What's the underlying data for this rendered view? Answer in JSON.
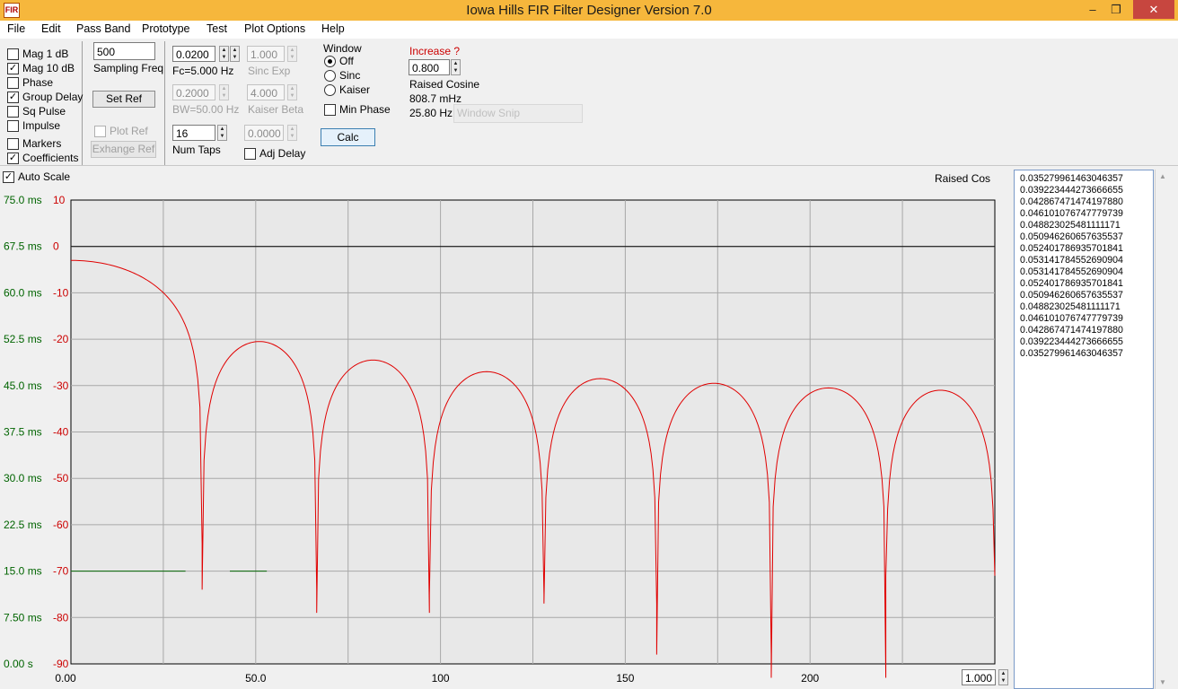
{
  "window": {
    "title": "Iowa Hills FIR Filter Designer  Version 7.0",
    "icon_label": "FIR",
    "minimize": "–",
    "maximize": "❐",
    "close": "✕"
  },
  "menu": [
    "File",
    "Edit",
    "Pass Band",
    "Prototype",
    "Test",
    "Plot Options",
    "Help"
  ],
  "display_options": [
    {
      "label": "Mag   1 dB",
      "checked": false
    },
    {
      "label": "Mag 10 dB",
      "checked": true
    },
    {
      "label": "Phase",
      "checked": false
    },
    {
      "label": "Group Delay",
      "checked": true
    },
    {
      "label": "Sq Pulse",
      "checked": false
    },
    {
      "label": "Impulse",
      "checked": false
    },
    {
      "label": "Markers",
      "checked": false
    },
    {
      "label": "Coefficients",
      "checked": true
    }
  ],
  "sampling": {
    "value": "500",
    "label": "Sampling Freq"
  },
  "buttons": {
    "set_ref": "Set Ref",
    "plot_ref": "Plot Ref",
    "exchange_ref": "Exhange Ref",
    "calc": "Calc",
    "window_snip": "Window Snip"
  },
  "params": {
    "fc_value": "0.0200",
    "fc_label": "Fc=5.000 Hz",
    "bw_value": "0.2000",
    "bw_label": "BW=50.00 Hz",
    "taps_value": "16",
    "taps_label": "Num Taps",
    "sinc_exp_value": "1.000",
    "sinc_exp_label": "Sinc Exp",
    "kaiser_beta_value": "4.000",
    "kaiser_beta_label": "Kaiser Beta",
    "adj_delay_value": "0.0000",
    "adj_delay_label": "Adj Delay"
  },
  "window_group": {
    "title": "Window",
    "options": [
      {
        "label": "Off",
        "selected": true
      },
      {
        "label": "Sinc",
        "selected": false
      },
      {
        "label": "Kaiser",
        "selected": false
      }
    ],
    "min_phase": "Min Phase"
  },
  "info": {
    "increase_label": "Increase ?",
    "increase_value": "0.800",
    "filter_name": "Raised Cosine",
    "freq1": "808.7 mHz",
    "freq2": "25.80 Hz"
  },
  "plot": {
    "auto_scale": "Auto Scale",
    "legend": "Raised Cos",
    "x_scale_value": "1.000",
    "left_axis": [
      "75.0 ms",
      "67.5 ms",
      "60.0 ms",
      "52.5 ms",
      "45.0 ms",
      "37.5 ms",
      "30.0 ms",
      "22.5 ms",
      "15.0 ms",
      "7.50 ms",
      "0.00 s"
    ],
    "right_axis": [
      "10",
      "0",
      "-10",
      "-20",
      "-30",
      "-40",
      "-50",
      "-60",
      "-70",
      "-80",
      "-90"
    ],
    "x_ticks": [
      "0.00",
      "50.0",
      "100",
      "150",
      "200"
    ],
    "colors": {
      "magnitude": "#e00000",
      "group_delay": "#000000",
      "grid": "#a8a8a8",
      "left_axis": "#006400",
      "right_axis": "#cc0000"
    }
  },
  "chart_data": {
    "type": "line",
    "title": "",
    "legend": [
      "Raised Cos"
    ],
    "xlim": [
      0,
      250
    ],
    "ylim_left": [
      0,
      75
    ],
    "ylim_right": [
      -90,
      10
    ],
    "series": [
      {
        "name": "Raised Cos",
        "axis": "right",
        "lobe_starts": [
          0,
          35.5,
          66.5,
          97,
          128,
          158.5,
          189.5,
          220.5
        ],
        "lobe_ends": [
          35.5,
          66.5,
          97,
          128,
          158.5,
          189.5,
          220.5,
          250
        ],
        "lobe_peaks_db": [
          -3,
          -20.5,
          -24.5,
          -27,
          -28.5,
          -29.5,
          -30.5,
          -31
        ],
        "null_depths_db": [
          -61,
          -74,
          -79,
          -75,
          -77,
          -88,
          -93,
          -71
        ]
      },
      {
        "axis": "left",
        "x": [
          0,
          250
        ],
        "y": [
          67.5,
          67.5
        ]
      },
      {
        "axis": "left",
        "segments": [
          [
            0,
            31
          ],
          [
            43,
            53
          ]
        ],
        "y": 15
      }
    ]
  },
  "coefficients": [
    "0.035279961463046357",
    "0.039223444273666655",
    "0.042867471474197880",
    "0.046101076747779739",
    "0.048823025481111171",
    "0.050946260657635537",
    "0.052401786935701841",
    "0.053141784552690904",
    "0.053141784552690904",
    "0.052401786935701841",
    "0.050946260657635537",
    "0.048823025481111171",
    "0.046101076747779739",
    "0.042867471474197880",
    "0.039223444273666655",
    "0.035279961463046357"
  ]
}
